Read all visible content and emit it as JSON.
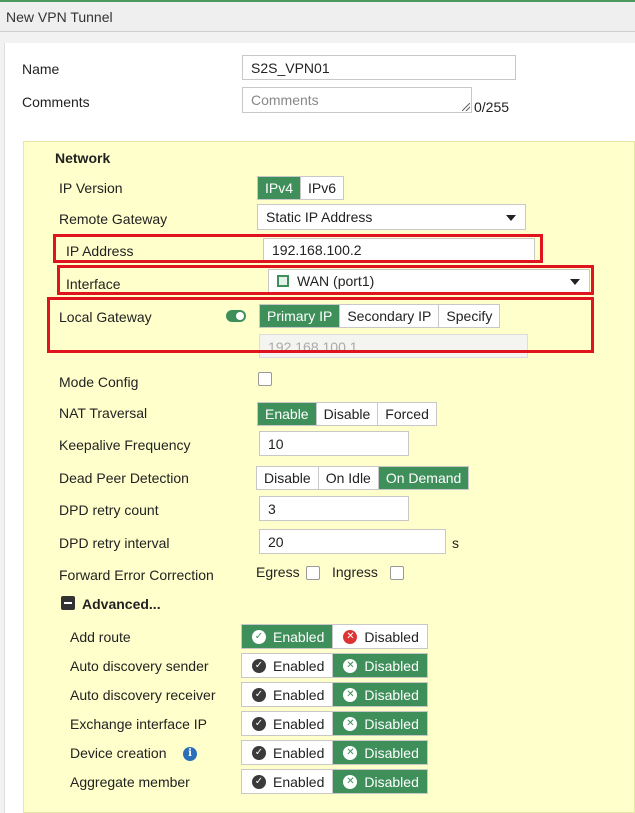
{
  "window": {
    "title": "New VPN Tunnel"
  },
  "form": {
    "name_label": "Name",
    "name_value": "S2S_VPN01",
    "comments_label": "Comments",
    "comments_placeholder": "Comments",
    "comments_counter": "0/255"
  },
  "network": {
    "section_title": "Network",
    "ip_version": {
      "label": "IP Version",
      "options": [
        "IPv4",
        "IPv6"
      ],
      "selected": "IPv4"
    },
    "remote_gateway": {
      "label": "Remote Gateway",
      "value": "Static IP Address"
    },
    "ip_address": {
      "label": "IP Address",
      "value": "192.168.100.2"
    },
    "interface": {
      "label": "Interface",
      "value": "WAN (port1)",
      "icon": "port-icon"
    },
    "local_gateway": {
      "label": "Local Gateway",
      "enabled": true,
      "options": [
        "Primary IP",
        "Secondary IP",
        "Specify"
      ],
      "selected": "Primary IP",
      "value": "192.168.100.1"
    },
    "mode_config": {
      "label": "Mode Config",
      "checked": false
    },
    "nat_traversal": {
      "label": "NAT Traversal",
      "options": [
        "Enable",
        "Disable",
        "Forced"
      ],
      "selected": "Enable"
    },
    "keepalive": {
      "label": "Keepalive Frequency",
      "value": "10"
    },
    "dpd": {
      "label": "Dead Peer Detection",
      "options": [
        "Disable",
        "On Idle",
        "On Demand"
      ],
      "selected": "On Demand"
    },
    "dpd_retry_count": {
      "label": "DPD retry count",
      "value": "3"
    },
    "dpd_retry_interval": {
      "label": "DPD retry interval",
      "value": "20",
      "unit": "s"
    },
    "fec": {
      "label": "Forward Error Correction",
      "egress": "Egress",
      "ingress": "Ingress"
    }
  },
  "advanced": {
    "title": "Advanced...",
    "enabled_label": "Enabled",
    "disabled_label": "Disabled",
    "rows": [
      {
        "label": "Add route",
        "selected": "Enabled"
      },
      {
        "label": "Auto discovery sender",
        "selected": "Disabled"
      },
      {
        "label": "Auto discovery receiver",
        "selected": "Disabled"
      },
      {
        "label": "Exchange interface IP",
        "selected": "Disabled"
      },
      {
        "label": "Device creation",
        "selected": "Disabled",
        "info": true
      },
      {
        "label": "Aggregate member",
        "selected": "Disabled"
      }
    ]
  },
  "colors": {
    "accent": "#3f8f5b",
    "highlight": "#e0141e",
    "section_bg": "#ffffcc"
  }
}
